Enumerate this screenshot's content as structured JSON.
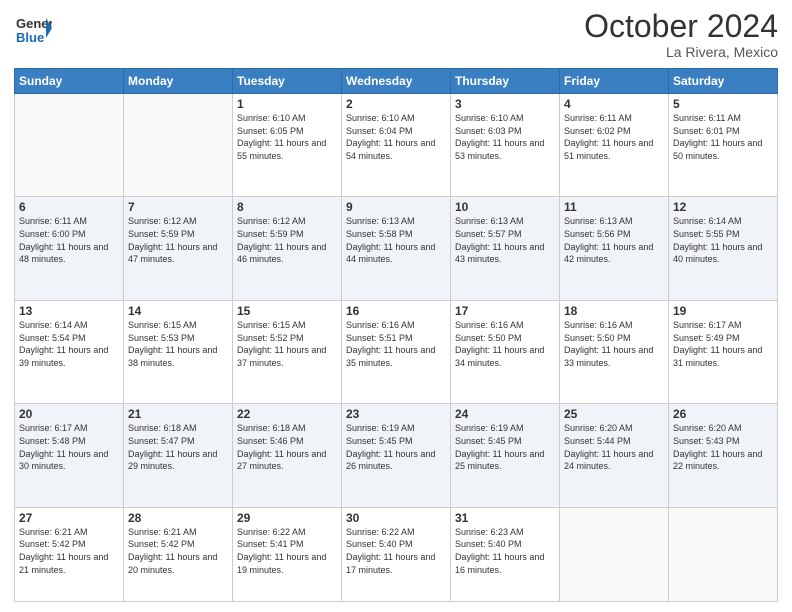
{
  "header": {
    "logo_line1": "General",
    "logo_line2": "Blue",
    "month": "October 2024",
    "location": "La Rivera, Mexico"
  },
  "days_of_week": [
    "Sunday",
    "Monday",
    "Tuesday",
    "Wednesday",
    "Thursday",
    "Friday",
    "Saturday"
  ],
  "weeks": [
    [
      {
        "day": "",
        "info": ""
      },
      {
        "day": "",
        "info": ""
      },
      {
        "day": "1",
        "info": "Sunrise: 6:10 AM\nSunset: 6:05 PM\nDaylight: 11 hours and 55 minutes."
      },
      {
        "day": "2",
        "info": "Sunrise: 6:10 AM\nSunset: 6:04 PM\nDaylight: 11 hours and 54 minutes."
      },
      {
        "day": "3",
        "info": "Sunrise: 6:10 AM\nSunset: 6:03 PM\nDaylight: 11 hours and 53 minutes."
      },
      {
        "day": "4",
        "info": "Sunrise: 6:11 AM\nSunset: 6:02 PM\nDaylight: 11 hours and 51 minutes."
      },
      {
        "day": "5",
        "info": "Sunrise: 6:11 AM\nSunset: 6:01 PM\nDaylight: 11 hours and 50 minutes."
      }
    ],
    [
      {
        "day": "6",
        "info": "Sunrise: 6:11 AM\nSunset: 6:00 PM\nDaylight: 11 hours and 48 minutes."
      },
      {
        "day": "7",
        "info": "Sunrise: 6:12 AM\nSunset: 5:59 PM\nDaylight: 11 hours and 47 minutes."
      },
      {
        "day": "8",
        "info": "Sunrise: 6:12 AM\nSunset: 5:59 PM\nDaylight: 11 hours and 46 minutes."
      },
      {
        "day": "9",
        "info": "Sunrise: 6:13 AM\nSunset: 5:58 PM\nDaylight: 11 hours and 44 minutes."
      },
      {
        "day": "10",
        "info": "Sunrise: 6:13 AM\nSunset: 5:57 PM\nDaylight: 11 hours and 43 minutes."
      },
      {
        "day": "11",
        "info": "Sunrise: 6:13 AM\nSunset: 5:56 PM\nDaylight: 11 hours and 42 minutes."
      },
      {
        "day": "12",
        "info": "Sunrise: 6:14 AM\nSunset: 5:55 PM\nDaylight: 11 hours and 40 minutes."
      }
    ],
    [
      {
        "day": "13",
        "info": "Sunrise: 6:14 AM\nSunset: 5:54 PM\nDaylight: 11 hours and 39 minutes."
      },
      {
        "day": "14",
        "info": "Sunrise: 6:15 AM\nSunset: 5:53 PM\nDaylight: 11 hours and 38 minutes."
      },
      {
        "day": "15",
        "info": "Sunrise: 6:15 AM\nSunset: 5:52 PM\nDaylight: 11 hours and 37 minutes."
      },
      {
        "day": "16",
        "info": "Sunrise: 6:16 AM\nSunset: 5:51 PM\nDaylight: 11 hours and 35 minutes."
      },
      {
        "day": "17",
        "info": "Sunrise: 6:16 AM\nSunset: 5:50 PM\nDaylight: 11 hours and 34 minutes."
      },
      {
        "day": "18",
        "info": "Sunrise: 6:16 AM\nSunset: 5:50 PM\nDaylight: 11 hours and 33 minutes."
      },
      {
        "day": "19",
        "info": "Sunrise: 6:17 AM\nSunset: 5:49 PM\nDaylight: 11 hours and 31 minutes."
      }
    ],
    [
      {
        "day": "20",
        "info": "Sunrise: 6:17 AM\nSunset: 5:48 PM\nDaylight: 11 hours and 30 minutes."
      },
      {
        "day": "21",
        "info": "Sunrise: 6:18 AM\nSunset: 5:47 PM\nDaylight: 11 hours and 29 minutes."
      },
      {
        "day": "22",
        "info": "Sunrise: 6:18 AM\nSunset: 5:46 PM\nDaylight: 11 hours and 27 minutes."
      },
      {
        "day": "23",
        "info": "Sunrise: 6:19 AM\nSunset: 5:45 PM\nDaylight: 11 hours and 26 minutes."
      },
      {
        "day": "24",
        "info": "Sunrise: 6:19 AM\nSunset: 5:45 PM\nDaylight: 11 hours and 25 minutes."
      },
      {
        "day": "25",
        "info": "Sunrise: 6:20 AM\nSunset: 5:44 PM\nDaylight: 11 hours and 24 minutes."
      },
      {
        "day": "26",
        "info": "Sunrise: 6:20 AM\nSunset: 5:43 PM\nDaylight: 11 hours and 22 minutes."
      }
    ],
    [
      {
        "day": "27",
        "info": "Sunrise: 6:21 AM\nSunset: 5:42 PM\nDaylight: 11 hours and 21 minutes."
      },
      {
        "day": "28",
        "info": "Sunrise: 6:21 AM\nSunset: 5:42 PM\nDaylight: 11 hours and 20 minutes."
      },
      {
        "day": "29",
        "info": "Sunrise: 6:22 AM\nSunset: 5:41 PM\nDaylight: 11 hours and 19 minutes."
      },
      {
        "day": "30",
        "info": "Sunrise: 6:22 AM\nSunset: 5:40 PM\nDaylight: 11 hours and 17 minutes."
      },
      {
        "day": "31",
        "info": "Sunrise: 6:23 AM\nSunset: 5:40 PM\nDaylight: 11 hours and 16 minutes."
      },
      {
        "day": "",
        "info": ""
      },
      {
        "day": "",
        "info": ""
      }
    ]
  ]
}
